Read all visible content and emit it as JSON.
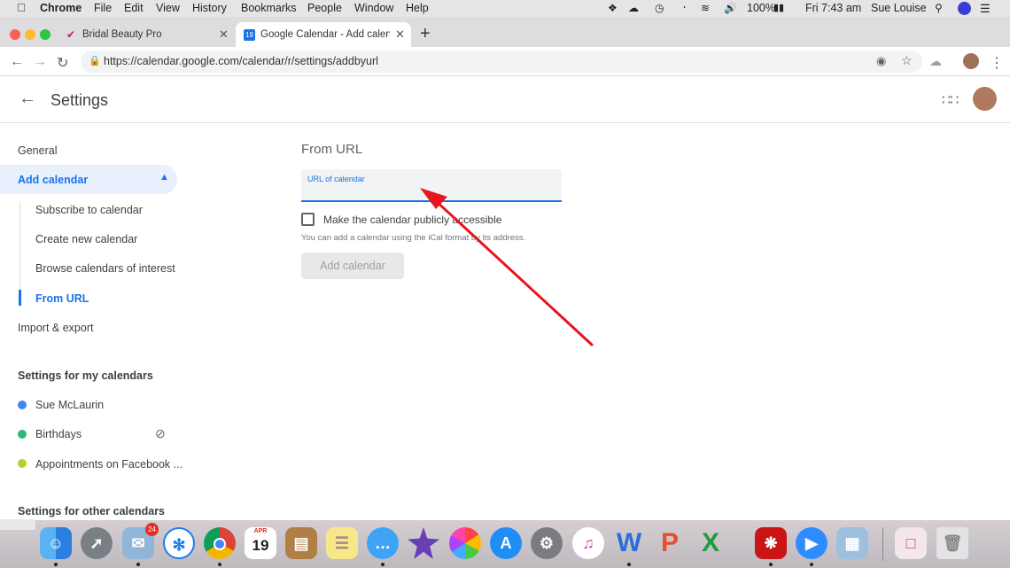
{
  "menubar": {
    "apple": "",
    "items": [
      "Chrome",
      "File",
      "Edit",
      "View",
      "History",
      "Bookmarks",
      "People",
      "Window",
      "Help"
    ],
    "battery": "100%",
    "clock": "Fri 7:43 am",
    "user": "Sue Louise"
  },
  "tabs": [
    {
      "title": "Bridal Beauty Pro",
      "icon": "bridal-icon",
      "color": "#c2185b"
    },
    {
      "title": "Google Calendar - Add calenda",
      "icon": "google-calendar-icon",
      "color": "#1a73e8",
      "icon_text": "19"
    }
  ],
  "address_bar": {
    "url": "https://calendar.google.com/calendar/r/settings/addbyurl"
  },
  "header": {
    "title": "Settings"
  },
  "sidebar": {
    "general": "General",
    "add_calendar": "Add calendar",
    "sub_items": [
      "Subscribe to calendar",
      "Create new calendar",
      "Browse calendars of interest",
      "From URL"
    ],
    "import_export": "Import & export",
    "my_calendars_heading": "Settings for my calendars",
    "my_calendars": [
      {
        "name": "Sue McLaurin",
        "color": "#4285f4"
      },
      {
        "name": "Birthdays",
        "color": "#33b679"
      },
      {
        "name": "Appointments on Facebook ...",
        "color": "#c0ca33"
      }
    ],
    "other_calendars_heading": "Settings for other calendars"
  },
  "main": {
    "section_title": "From URL",
    "url_field_label": "URL of calendar",
    "url_field_value": "",
    "checkbox_label": "Make the calendar publicly accessible",
    "checkbox_checked": false,
    "helper_text": "You can add a calendar using the iCal format by its address.",
    "add_button": "Add calendar"
  },
  "dock": {
    "calendar_month": "APR",
    "calendar_day": "19",
    "mail_badge": "24",
    "apps": [
      "Finder",
      "Launchpad",
      "Mail",
      "Safari",
      "Chrome",
      "Calendar",
      "Notes Book",
      "Notes",
      "Messages",
      "iMovie",
      "Photos",
      "App Store",
      "System Preferences",
      "iTunes",
      "Word",
      "PowerPoint",
      "Excel",
      "Acrobat",
      "Zoom",
      "Preview",
      "Screenshot",
      "Trash"
    ]
  },
  "colors": {
    "accent": "#1a73e8",
    "arrow": "#e8141e"
  }
}
